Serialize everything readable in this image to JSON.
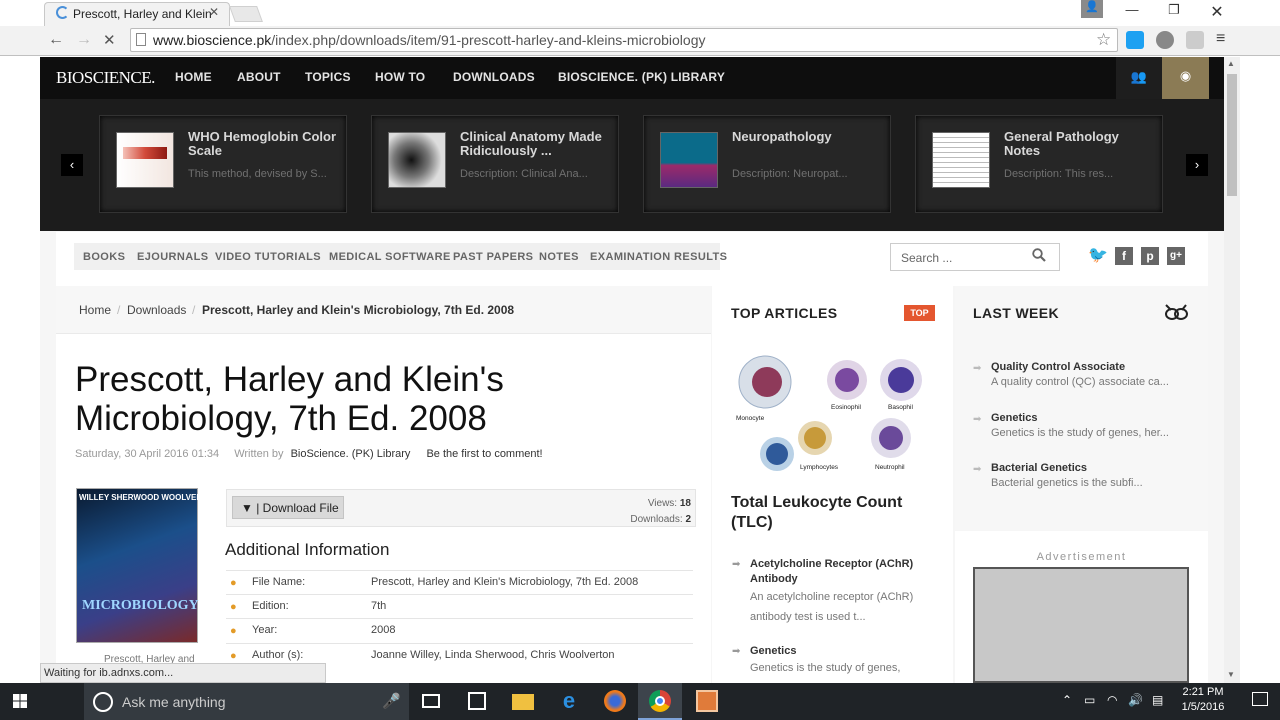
{
  "browser": {
    "tab_title": "Prescott, Harley and Klein",
    "url_host": "www.bioscience.pk",
    "url_path": "/index.php/downloads/item/91-prescott-harley-and-kleins-microbiology",
    "status": "Waiting for ib.adnxs.com..."
  },
  "site": {
    "logo": "BIOSCIENCE.",
    "nav": [
      "HOME",
      "ABOUT",
      "TOPICS",
      "HOW TO",
      "DOWNLOADS",
      "BIOSCIENCE. (PK) LIBRARY"
    ],
    "carousel": [
      {
        "title": "WHO Hemoglobin Color Scale",
        "desc": "This method, devised by S..."
      },
      {
        "title": "Clinical Anatomy Made Ridiculously ...",
        "desc": "Description: Clinical Ana..."
      },
      {
        "title": "Neuropathology",
        "desc": "Description: Neuropat..."
      },
      {
        "title": "General Pathology Notes",
        "desc": "Description: This res..."
      }
    ],
    "subnav": [
      "BOOKS",
      "EJOURNALS",
      "VIDEO TUTORIALS",
      "MEDICAL SOFTWARE",
      "PAST PAPERS",
      "NOTES",
      "EXAMINATION RESULTS"
    ],
    "search_placeholder": "Search ...",
    "social": [
      "twitter",
      "f",
      "p",
      "g+"
    ]
  },
  "breadcrumb": [
    "Home",
    "Downloads",
    "Prescott, Harley and Klein's Microbiology, 7th Ed. 2008"
  ],
  "article": {
    "title": "Prescott, Harley and Klein's Microbiology, 7th Ed. 2008",
    "date": "Saturday, 30 April 2016 01:34",
    "written_by_label": "Written by",
    "author": "BioScience. (PK) Library",
    "comment": "Be the first to comment!",
    "cover_authors": "WILLEY  SHERWOOD  WOOLVERTON",
    "cover_title": "MICROBIOLOGY",
    "cover_caption": "Prescott, Harley and",
    "download_label": "| Download File",
    "views_label": "Views:",
    "views": "18",
    "downloads_label": "Downloads:",
    "downloads": "2",
    "additional_info": "Additional Information",
    "info": [
      {
        "key": "File Name:",
        "value": "Prescott, Harley and Klein's Microbiology, 7th Ed. 2008"
      },
      {
        "key": "Edition:",
        "value": "7th"
      },
      {
        "key": "Year:",
        "value": "2008"
      },
      {
        "key": "Author (s):",
        "value": "Joanne Willey, Linda Sherwood, Chris Woolverton"
      }
    ]
  },
  "top_articles": {
    "title": "TOP ARTICLES",
    "badge": "TOP",
    "cell_labels": [
      "Monocyte",
      "Eosinophil",
      "Basophil",
      "Lymphocytes",
      "Neutrophil"
    ],
    "featured": "Total Leukocyte Count (TLC)",
    "items": [
      {
        "title": "Acetylcholine Receptor (AChR) Antibody",
        "desc": "An acetylcholine receptor (AChR) antibody test is used t..."
      },
      {
        "title": "Genetics",
        "desc": "Genetics is the study of genes,"
      }
    ]
  },
  "last_week": {
    "title": "LAST WEEK",
    "items": [
      {
        "title": "Quality Control Associate",
        "desc": "A quality control (QC) associate ca..."
      },
      {
        "title": "Genetics",
        "desc": "Genetics is the study of genes, her..."
      },
      {
        "title": "Bacterial Genetics",
        "desc": "Bacterial genetics is the subfi..."
      }
    ]
  },
  "advertisement": "Advertisement",
  "taskbar": {
    "search_text": "Ask me anything",
    "time": "2:21 PM",
    "date": "1/5/2016"
  }
}
